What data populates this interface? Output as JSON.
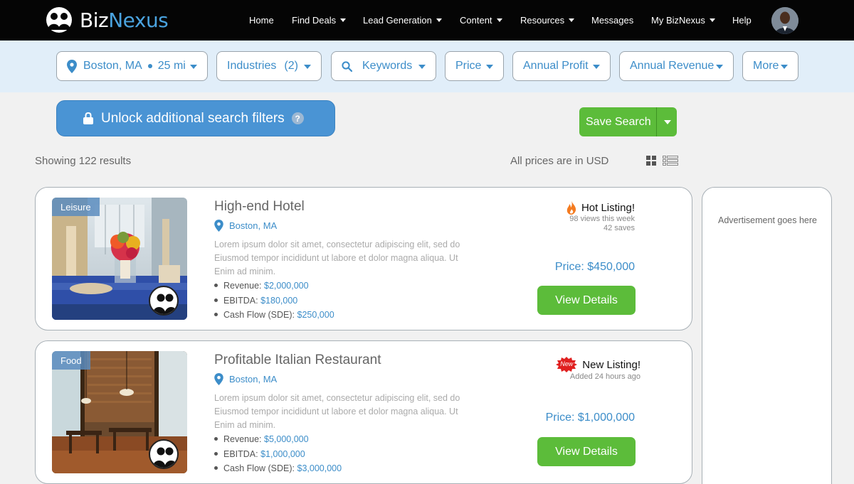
{
  "nav": {
    "logo_part1": "Biz",
    "logo_part2": "Nexus",
    "items": [
      {
        "label": "Home"
      },
      {
        "label": "Find Deals"
      },
      {
        "label": "Lead Generation"
      },
      {
        "label": "Content"
      },
      {
        "label": "Resources"
      },
      {
        "label": "Messages"
      },
      {
        "label": "My BizNexus"
      },
      {
        "label": "Help"
      }
    ]
  },
  "filters": {
    "location": "Boston, MA",
    "radius": "25 mi",
    "industries": "Industries",
    "industries_count": "(2)",
    "keywords": "Keywords",
    "price": "Price",
    "annual_profit": "Annual Profit",
    "annual_revenue": "Annual Revenue",
    "more": "More"
  },
  "actions": {
    "unlock_label": "Unlock additional search filters",
    "help_glyph": "?",
    "save_search_label": "Save Search"
  },
  "summary": {
    "results_text": "Showing 122 results",
    "currency_note": "All prices are in USD"
  },
  "listings": [
    {
      "category": "Leisure",
      "title": "High-end Hotel",
      "location": "Boston, MA",
      "description": "Lorem ipsum dolor sit amet, consectetur adipiscing elit, sed do Eiusmod tempor incididunt ut labore et dolor magna aliqua. Ut Enim ad minim.",
      "revenue_label": "Revenue:",
      "revenue_value": "$2,000,000",
      "ebitda_label": "EBITDA:",
      "ebitda_value": "$180,000",
      "cashflow_label": "Cash Flow (SDE):",
      "cashflow_value": "$250,000",
      "badge_title": "Hot Listing!",
      "badge_line1": "98 views this week",
      "badge_line2": "42 saves",
      "price": "Price: $450,000",
      "button": "View Details"
    },
    {
      "category": "Food",
      "title": "Profitable Italian Restaurant",
      "location": "Boston, MA",
      "description": "Lorem ipsum dolor sit amet, consectetur adipiscing elit, sed do Eiusmod tempor incididunt ut labore et dolor magna aliqua. Ut Enim ad minim.",
      "revenue_label": "Revenue:",
      "revenue_value": "$5,000,000",
      "ebitda_label": "EBITDA:",
      "ebitda_value": "$1,000,000",
      "cashflow_label": "Cash Flow (SDE):",
      "cashflow_value": "$3,000,000",
      "badge_title": "New Listing!",
      "badge_sticker": "New",
      "badge_line1": "Added 24 hours ago",
      "price": "Price: $1,000,000",
      "button": "View Details"
    }
  ],
  "advertisement": {
    "text": "Advertisement goes here"
  },
  "colors": {
    "nav_bg": "#050505",
    "accent_blue": "#3c8dc9",
    "filter_bar_bg": "#e1eef9",
    "unlock_blue": "#4a94d4",
    "action_green": "#5cbc3a",
    "page_bg": "#f1f1f1",
    "hot_orange": "#f47b20",
    "new_red": "#e02020"
  },
  "icons": {
    "location": "map-pin-icon",
    "search": "magnifier-icon",
    "lock": "padlock-icon",
    "hot": "flame-icon",
    "new": "starburst-sticker-icon",
    "grid_view": "grid-icon",
    "list_view": "list-icon",
    "broker_seal": "users-silhouette-icon"
  }
}
